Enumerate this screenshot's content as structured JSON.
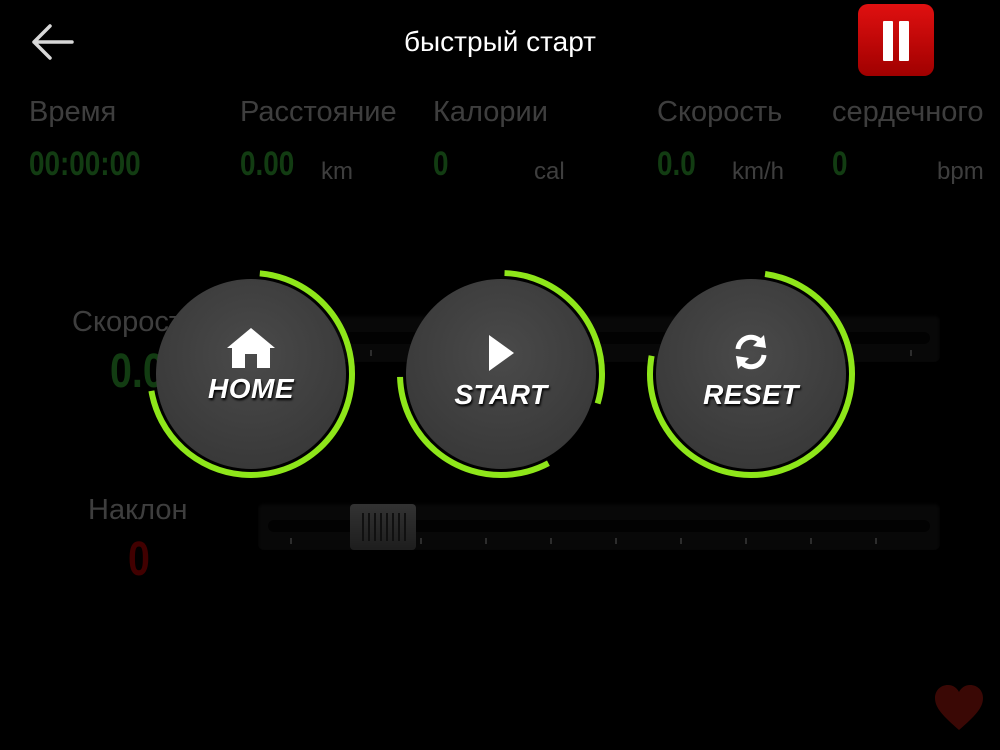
{
  "header": {
    "title": "быстрый старт",
    "back_icon": "arrow-left-icon",
    "pause_icon": "pause-icon"
  },
  "stats": {
    "time": {
      "label": "Время",
      "value": "00:00:00"
    },
    "distance": {
      "label": "Расстояние",
      "value": "0.00",
      "unit": "km"
    },
    "calories": {
      "label": "Калории",
      "value": "0",
      "unit": "cal"
    },
    "speed": {
      "label": "Скорость",
      "value": "0.0",
      "unit": "km/h"
    },
    "heart_rate": {
      "label": "сердечного",
      "value": "0",
      "unit": "bpm"
    }
  },
  "controls": {
    "speed": {
      "label": "Скорость",
      "value": "0.0"
    },
    "incline": {
      "label": "Наклон",
      "value": "0"
    }
  },
  "overlay": {
    "home": {
      "label": "HOME",
      "icon": "home-icon"
    },
    "start": {
      "label": "START",
      "icon": "play-icon"
    },
    "reset": {
      "label": "RESET",
      "icon": "refresh-icon"
    }
  },
  "colors": {
    "accent_green": "#8ee61a",
    "value_green": "#39b539",
    "incline_red": "#c40000",
    "pause_red": "#d40a0a"
  }
}
